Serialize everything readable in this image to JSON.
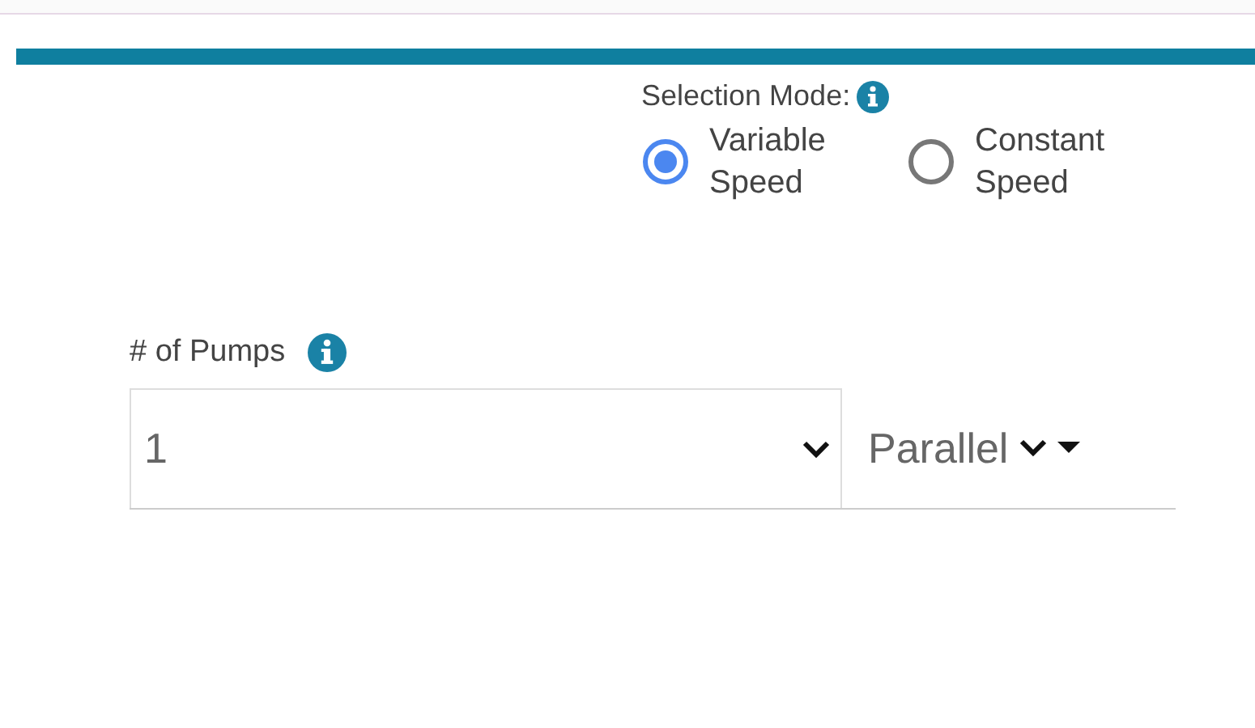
{
  "selection_mode": {
    "label": "Selection Mode:",
    "options": [
      {
        "label": "Variable Speed",
        "selected": true
      },
      {
        "label": "Constant Speed",
        "selected": false
      }
    ]
  },
  "pumps": {
    "label": "# of Pumps",
    "count": "1",
    "arrangement": "Parallel"
  }
}
